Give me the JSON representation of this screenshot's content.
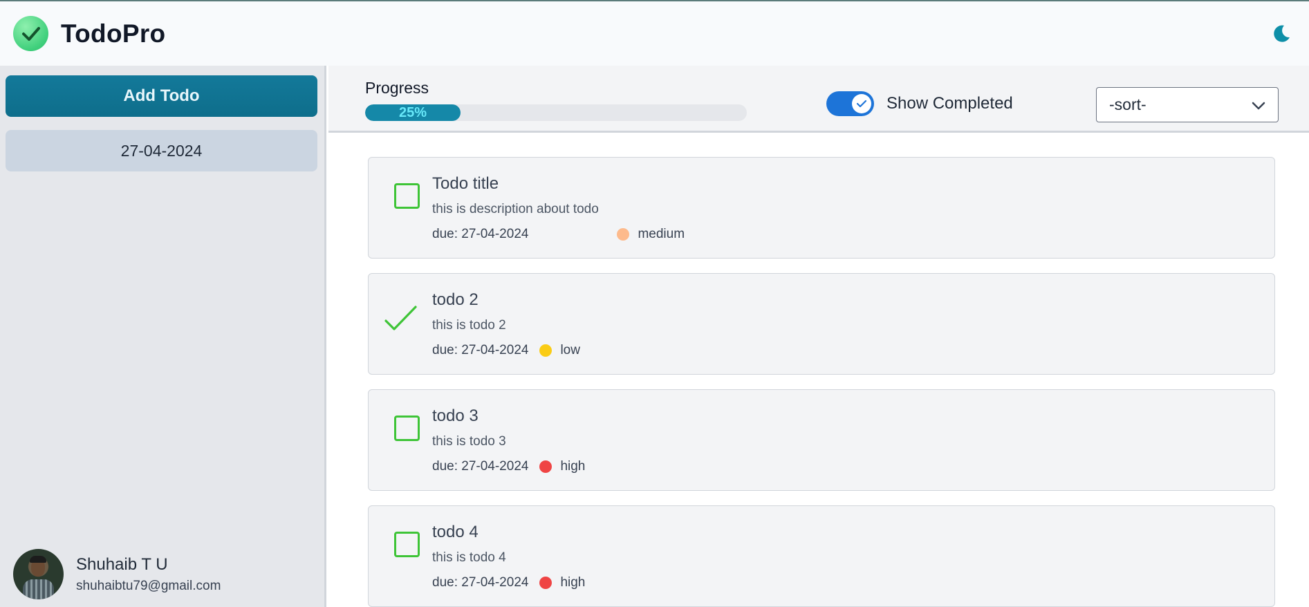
{
  "app": {
    "name": "TodoPro",
    "icons": {
      "logo": "check-circle-icon",
      "theme": "moon-icon"
    }
  },
  "sidebar": {
    "add_button_label": "Add Todo",
    "date_item": "27-04-2024",
    "user": {
      "name": "Shuhaib T U",
      "email": "shuhaibtu79@gmail.com"
    }
  },
  "toolbar": {
    "progress_label": "Progress",
    "progress_percent": 25,
    "progress_text": "25%",
    "show_completed_label": "Show Completed",
    "show_completed_on": true,
    "sort_value": "-sort-"
  },
  "todos": [
    {
      "title": "Todo title",
      "description": "this is description about todo",
      "due": "due: 27-04-2024",
      "priority": "medium",
      "priority_color": "#fdba8c",
      "completed": false
    },
    {
      "title": "todo 2",
      "description": "this is todo 2",
      "due": "due: 27-04-2024",
      "priority": "low",
      "priority_color": "#facc15",
      "completed": true
    },
    {
      "title": "todo 3",
      "description": "this is todo 3",
      "due": "due: 27-04-2024",
      "priority": "high",
      "priority_color": "#ef4444",
      "completed": false
    },
    {
      "title": "todo 4",
      "description": "this is todo 4",
      "due": "due: 27-04-2024",
      "priority": "high",
      "priority_color": "#ef4444",
      "completed": false
    }
  ],
  "colors": {
    "accent": "#0e7490",
    "toggle": "#1d74d8",
    "check": "#3ec437"
  }
}
